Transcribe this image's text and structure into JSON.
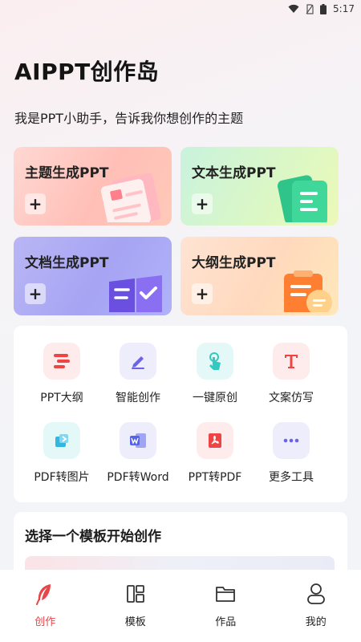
{
  "status_bar": {
    "time": "5:17"
  },
  "header": {
    "app_title": "AIPPT创作岛",
    "subtitle": "我是PPT小助手，告诉我你想创作的主题"
  },
  "cards": [
    {
      "title": "主题生成PPT",
      "add": "+"
    },
    {
      "title": "文本生成PPT",
      "add": "+"
    },
    {
      "title": "文档生成PPT",
      "add": "+"
    },
    {
      "title": "大纲生成PPT",
      "add": "+"
    }
  ],
  "tools": [
    {
      "label": "PPT大纲"
    },
    {
      "label": "智能创作"
    },
    {
      "label": "一键原创"
    },
    {
      "label": "文案仿写"
    },
    {
      "label": "PDF转图片"
    },
    {
      "label": "PDF转Word"
    },
    {
      "label": "PPT转PDF"
    },
    {
      "label": "更多工具"
    }
  ],
  "template_section": {
    "heading": "选择一个模板开始创作"
  },
  "bottom_nav": [
    {
      "label": "创作",
      "icon": "feather-icon",
      "active": true
    },
    {
      "label": "模板",
      "icon": "layout-icon"
    },
    {
      "label": "作品",
      "icon": "folder-icon"
    },
    {
      "label": "我的",
      "icon": "person-icon"
    }
  ],
  "colors": {
    "accent": "#e8454a"
  }
}
